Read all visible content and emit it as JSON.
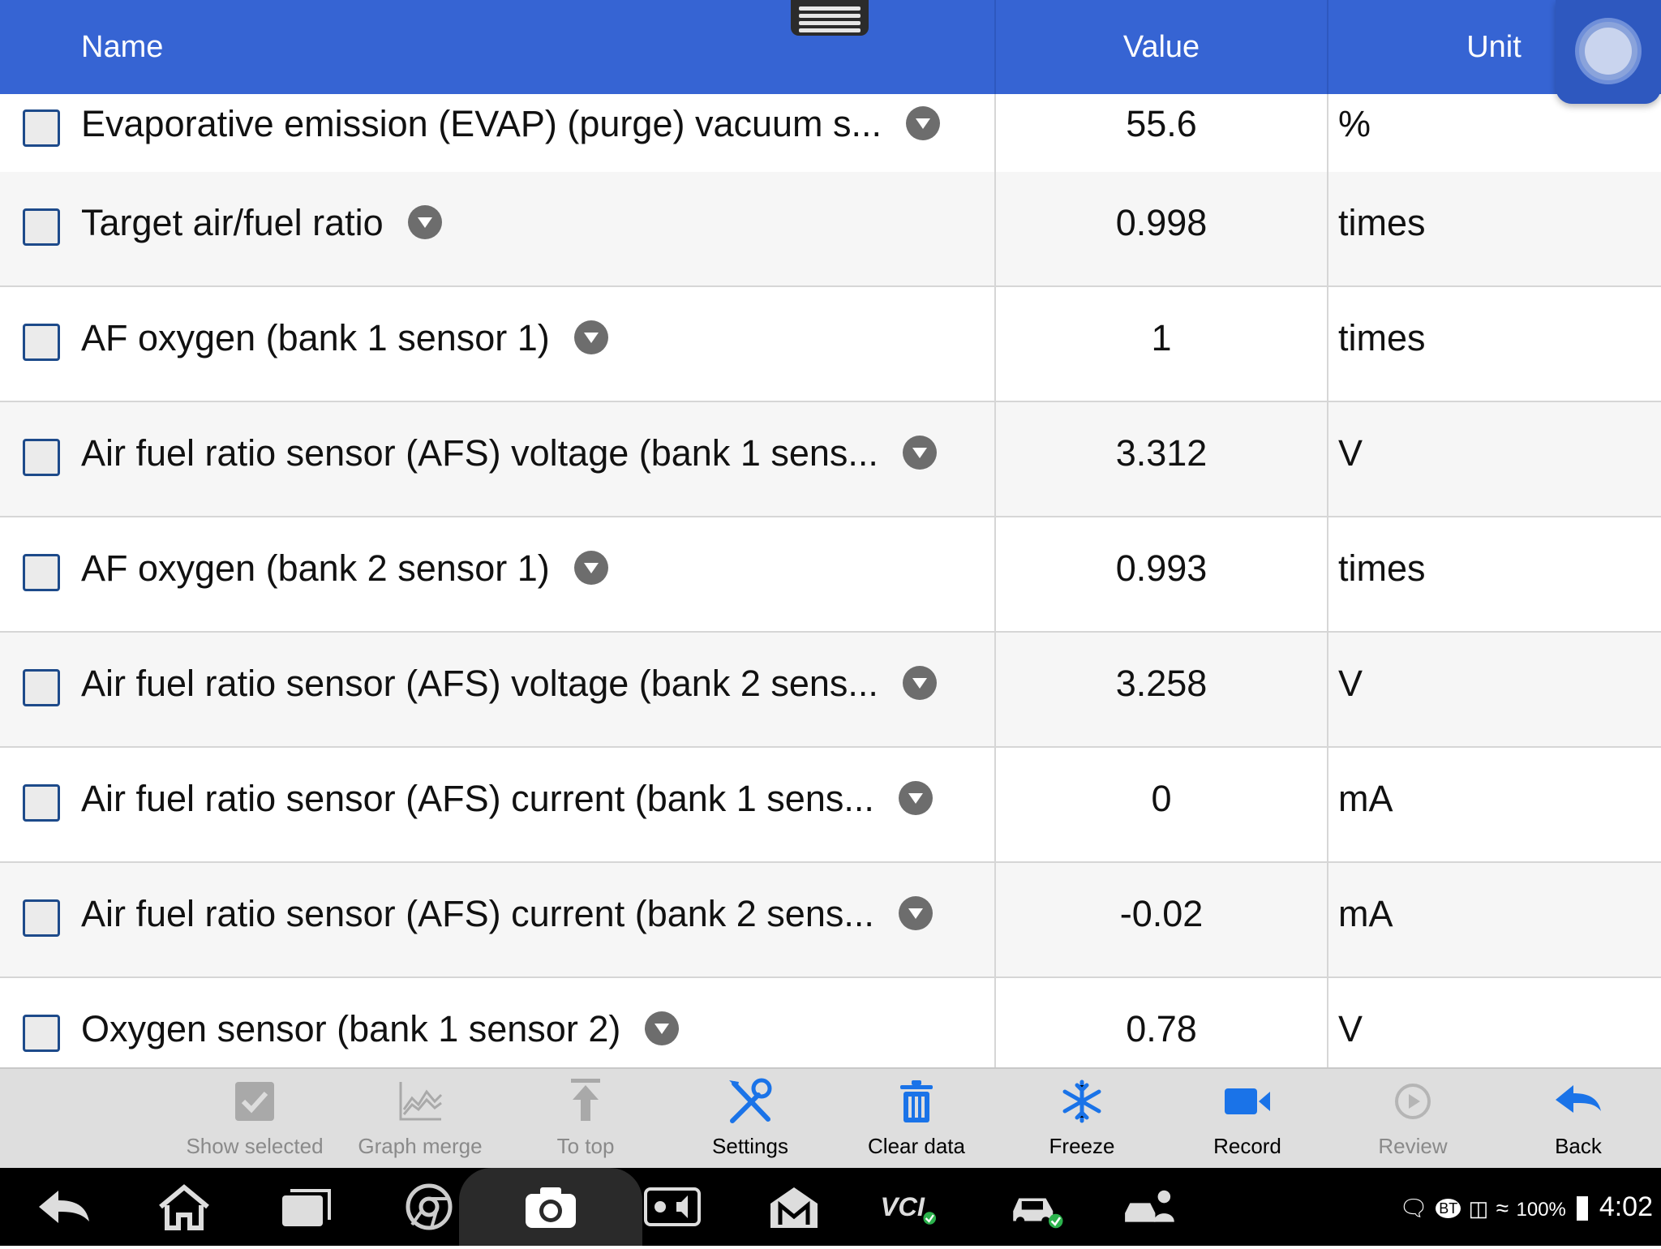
{
  "header": {
    "name_label": "Name",
    "value_label": "Value",
    "unit_label": "Unit"
  },
  "rows": [
    {
      "name": "Evaporative emission (EVAP) (purge) vacuum s...",
      "value": "55.6",
      "unit": "%"
    },
    {
      "name": "Target air/fuel ratio",
      "value": "0.998",
      "unit": "times"
    },
    {
      "name": "AF oxygen (bank 1 sensor 1)",
      "value": "1",
      "unit": "times"
    },
    {
      "name": "Air fuel ratio sensor (AFS) voltage (bank 1 sens...",
      "value": "3.312",
      "unit": "V"
    },
    {
      "name": "AF oxygen (bank 2 sensor 1)",
      "value": "0.993",
      "unit": "times"
    },
    {
      "name": "Air fuel ratio sensor (AFS) voltage (bank 2 sens...",
      "value": "3.258",
      "unit": "V"
    },
    {
      "name": "Air fuel ratio sensor (AFS) current (bank 1 sens...",
      "value": "0",
      "unit": "mA"
    },
    {
      "name": "Air fuel ratio sensor (AFS) current (bank 2 sens...",
      "value": "-0.02",
      "unit": "mA"
    },
    {
      "name": "Oxygen sensor (bank 1 sensor 2)",
      "value": "0.78",
      "unit": "V"
    }
  ],
  "toolbar": {
    "show_selected": "Show selected",
    "graph_merge": "Graph merge",
    "to_top": "To top",
    "settings": "Settings",
    "clear_data": "Clear data",
    "freeze": "Freeze",
    "record": "Record",
    "review": "Review",
    "back": "Back"
  },
  "colors": {
    "header_bg": "#3664d3",
    "accent_blue": "#1a73e8",
    "toolbar_bg": "#dedede"
  },
  "status": {
    "battery": "100%",
    "time": "4:02",
    "bt": "BT"
  }
}
